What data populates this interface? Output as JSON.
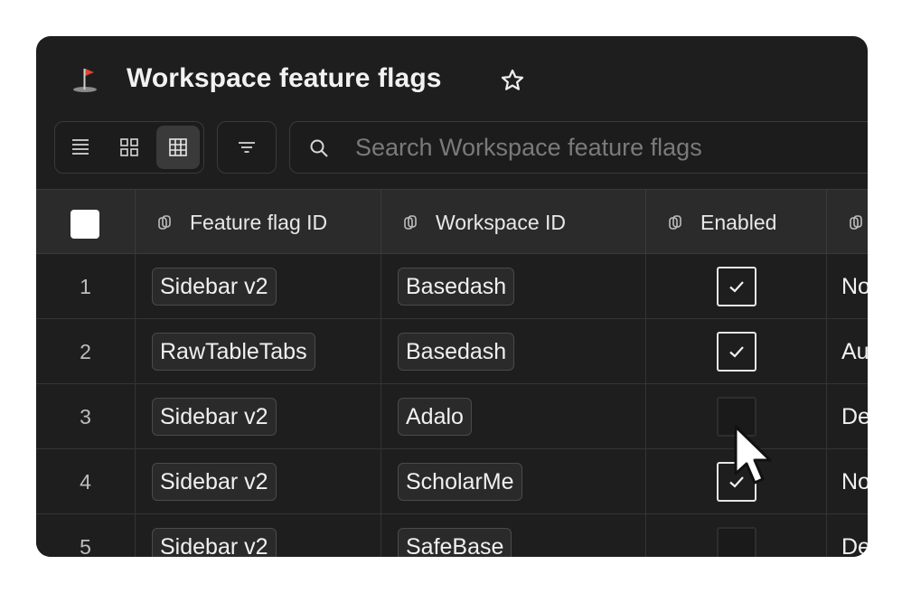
{
  "window": {
    "title": "Workspace feature flags",
    "title_icon": "golf-flag-icon",
    "favorite_icon": "star-outline-icon"
  },
  "toolbar": {
    "view_modes": [
      {
        "name": "list-view",
        "icon": "list-icon",
        "active": false
      },
      {
        "name": "gallery-view",
        "icon": "grid-icon",
        "active": false
      },
      {
        "name": "table-view",
        "icon": "table-icon",
        "active": true
      }
    ],
    "filter_icon": "filter-icon",
    "search": {
      "placeholder": "Search Workspace feature flags",
      "value": "",
      "icon": "search-icon"
    }
  },
  "table": {
    "columns": [
      {
        "key": "feature_flag_id",
        "label": "Feature flag ID",
        "icon": "relation-icon"
      },
      {
        "key": "workspace_id",
        "label": "Workspace ID",
        "icon": "relation-icon"
      },
      {
        "key": "enabled",
        "label": "Enabled",
        "icon": "relation-icon"
      },
      {
        "key": "next",
        "label": "",
        "icon": "relation-icon"
      }
    ],
    "rows": [
      {
        "num": "1",
        "feature_flag_id": "Sidebar v2",
        "workspace_id": "Basedash",
        "enabled": true,
        "next": "No"
      },
      {
        "num": "2",
        "feature_flag_id": "RawTableTabs",
        "workspace_id": "Basedash",
        "enabled": true,
        "next": "Au"
      },
      {
        "num": "3",
        "feature_flag_id": "Sidebar v2",
        "workspace_id": "Adalo",
        "enabled": false,
        "next": "De"
      },
      {
        "num": "4",
        "feature_flag_id": "Sidebar v2",
        "workspace_id": "ScholarMe",
        "enabled": true,
        "next": "No"
      },
      {
        "num": "5",
        "feature_flag_id": "Sidebar v2",
        "workspace_id": "SafeBase",
        "enabled": false,
        "next": "De"
      }
    ]
  },
  "colors": {
    "background": "#1e1e1e",
    "header_bg": "#2b2b2b",
    "border": "#3a3a3a",
    "text": "#f0f0f0"
  }
}
